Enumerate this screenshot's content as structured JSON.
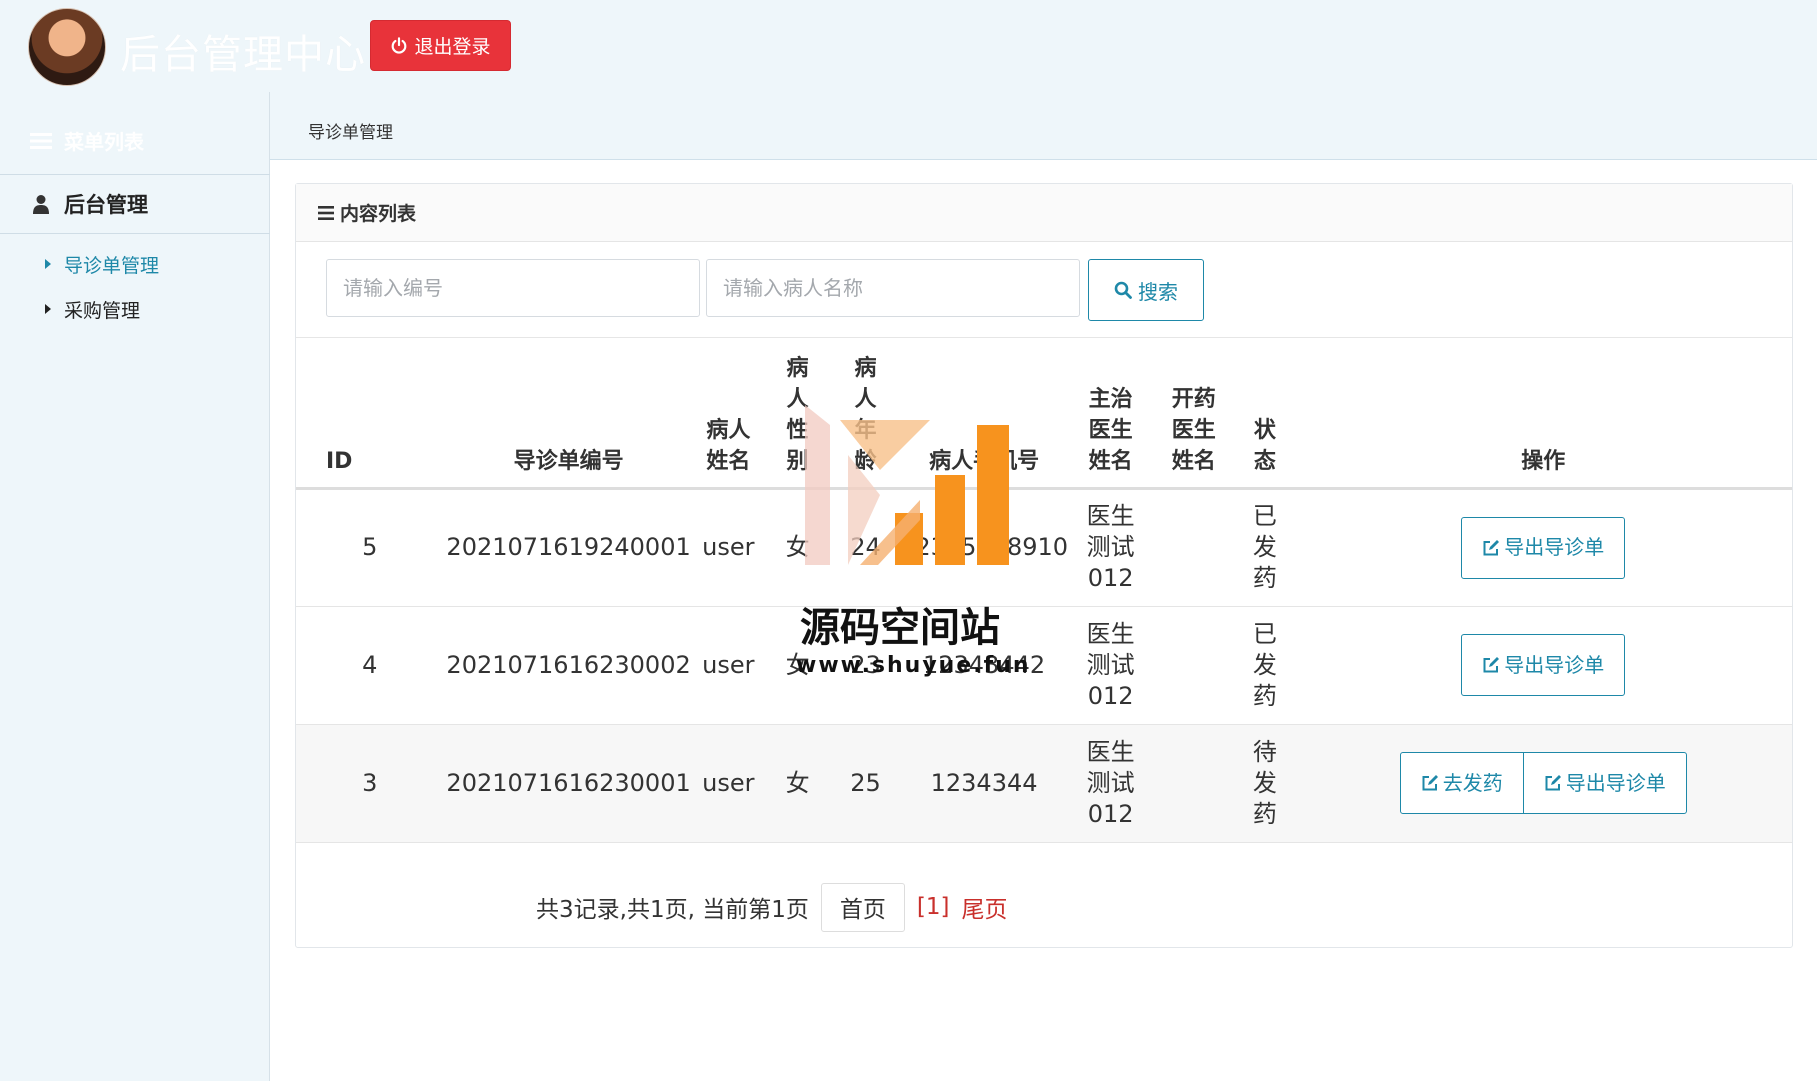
{
  "header": {
    "title": "后台管理中心",
    "logout_label": "退出登录"
  },
  "sidebar": {
    "title": "菜单列表",
    "group_label": "后台管理",
    "items": [
      {
        "label": "导诊单管理"
      },
      {
        "label": "采购管理"
      }
    ]
  },
  "breadcrumb": "导诊单管理",
  "panel": {
    "heading": "内容列表"
  },
  "search": {
    "code_placeholder": "请输入编号",
    "name_placeholder": "请输入病人名称",
    "button_label": "搜索"
  },
  "table": {
    "headers": [
      "ID",
      "导诊单编号",
      "病人姓名",
      "病人性别",
      "病人年龄",
      "病人手机号",
      "主治医生姓名",
      "开药医生姓名",
      "状态",
      "操作"
    ],
    "rows": [
      {
        "id": "5",
        "code": "2021071619240001",
        "name": "user",
        "gender": "女",
        "age": "24",
        "phone": "12345678910",
        "doctor": "医生测试012",
        "prescriber": "",
        "status": "已发药",
        "actions": [
          "导出导诊单"
        ]
      },
      {
        "id": "4",
        "code": "2021071616230002",
        "name": "user",
        "gender": "女",
        "age": "23",
        "phone": "12343442",
        "doctor": "医生测试012",
        "prescriber": "",
        "status": "已发药",
        "actions": [
          "导出导诊单"
        ]
      },
      {
        "id": "3",
        "code": "2021071616230001",
        "name": "user",
        "gender": "女",
        "age": "25",
        "phone": "1234344",
        "doctor": "医生测试012",
        "prescriber": "",
        "status": "待发药",
        "actions": [
          "去发药",
          "导出导诊单"
        ]
      }
    ]
  },
  "pagination": {
    "summary": "共3记录,共1页, 当前第1页",
    "first_label": "首页",
    "current_label": "[1]",
    "last_label": "尾页"
  },
  "watermark": {
    "title": "源码空间站",
    "url": "www.shuyue.fun"
  },
  "colors": {
    "accent": "#1e88a8",
    "danger": "#e8333a",
    "background": "#eef6fa",
    "watermark_orange": "#f7931e"
  }
}
